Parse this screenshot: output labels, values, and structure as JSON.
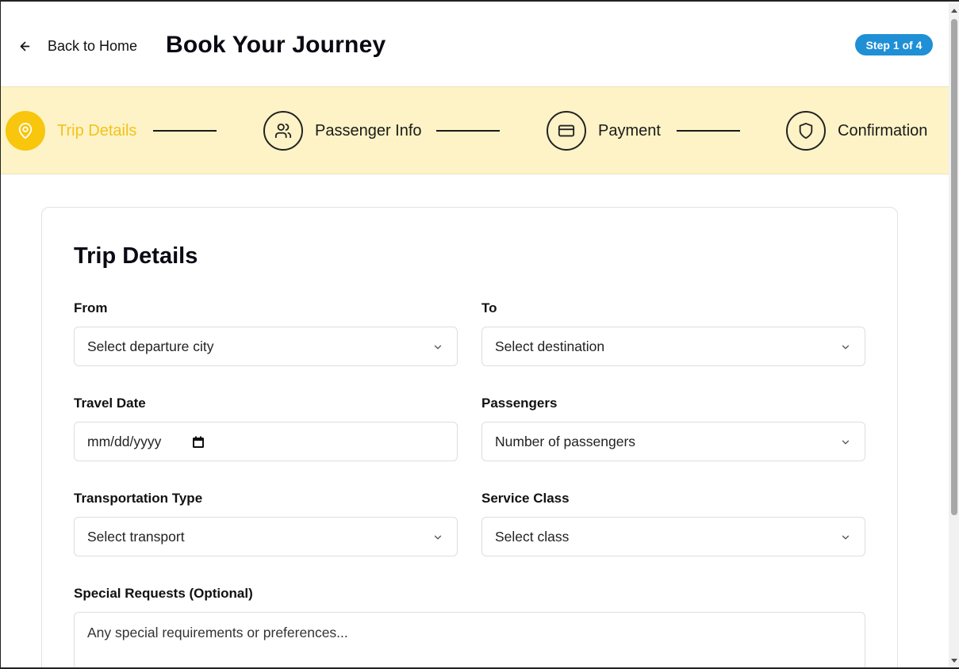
{
  "header": {
    "back_label": "Back to Home",
    "title": "Book Your Journey",
    "step_badge": "Step 1 of 4"
  },
  "stepper": {
    "steps": [
      {
        "label": "Trip Details",
        "icon": "map-pin-icon",
        "active": true
      },
      {
        "label": "Passenger Info",
        "icon": "users-icon",
        "active": false
      },
      {
        "label": "Payment",
        "icon": "credit-card-icon",
        "active": false
      },
      {
        "label": "Confirmation",
        "icon": "shield-icon",
        "active": false
      }
    ]
  },
  "form": {
    "title": "Trip Details",
    "from": {
      "label": "From",
      "placeholder": "Select departure city"
    },
    "to": {
      "label": "To",
      "placeholder": "Select destination"
    },
    "travel_date": {
      "label": "Travel Date",
      "placeholder": "mm/dd/yyyy"
    },
    "passengers": {
      "label": "Passengers",
      "placeholder": "Number of passengers"
    },
    "transport": {
      "label": "Transportation Type",
      "placeholder": "Select transport"
    },
    "service_class": {
      "label": "Service Class",
      "placeholder": "Select class"
    },
    "special_requests": {
      "label": "Special Requests (Optional)",
      "placeholder": "Any special requirements or preferences..."
    }
  },
  "colors": {
    "accent": "#f7c60d",
    "stepper_bg": "#fdf3c6",
    "badge": "#1f8fd6"
  }
}
